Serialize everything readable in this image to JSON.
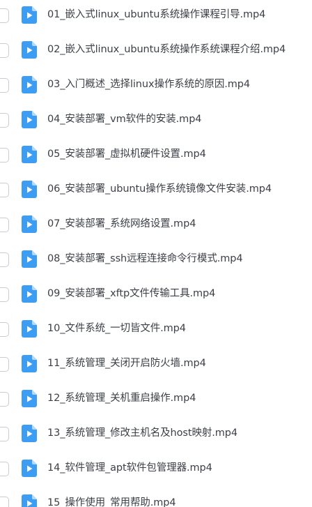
{
  "file_list": {
    "icon": "video-file-icon",
    "accent_color": "#3d9df2",
    "items": [
      {
        "name": "01_嵌入式linux_ubuntu系统操作课程引导.mp4"
      },
      {
        "name": "02_嵌入式linux_ubuntu系统操作系统课程介绍.mp4"
      },
      {
        "name": "03_入门概述_选择linux操作系统的原因.mp4"
      },
      {
        "name": "04_安装部署_vm软件的安装.mp4"
      },
      {
        "name": "05_安装部署_虚拟机硬件设置.mp4"
      },
      {
        "name": "06_安装部署_ubuntu操作系统镜像文件安装.mp4"
      },
      {
        "name": "07_安装部署_系统网络设置.mp4"
      },
      {
        "name": "08_安装部署_ssh远程连接命令行模式.mp4"
      },
      {
        "name": "09_安装部署_xftp文件传输工具.mp4"
      },
      {
        "name": "10_文件系统_一切皆文件.mp4"
      },
      {
        "name": "11_系统管理_关闭开启防火墙.mp4"
      },
      {
        "name": "12_系统管理_关机重启操作.mp4"
      },
      {
        "name": "13_系统管理_修改主机名及host映射.mp4"
      },
      {
        "name": "14_软件管理_apt软件包管理器.mp4"
      },
      {
        "name": "15_操作使用_常用帮助.mp4"
      }
    ]
  }
}
